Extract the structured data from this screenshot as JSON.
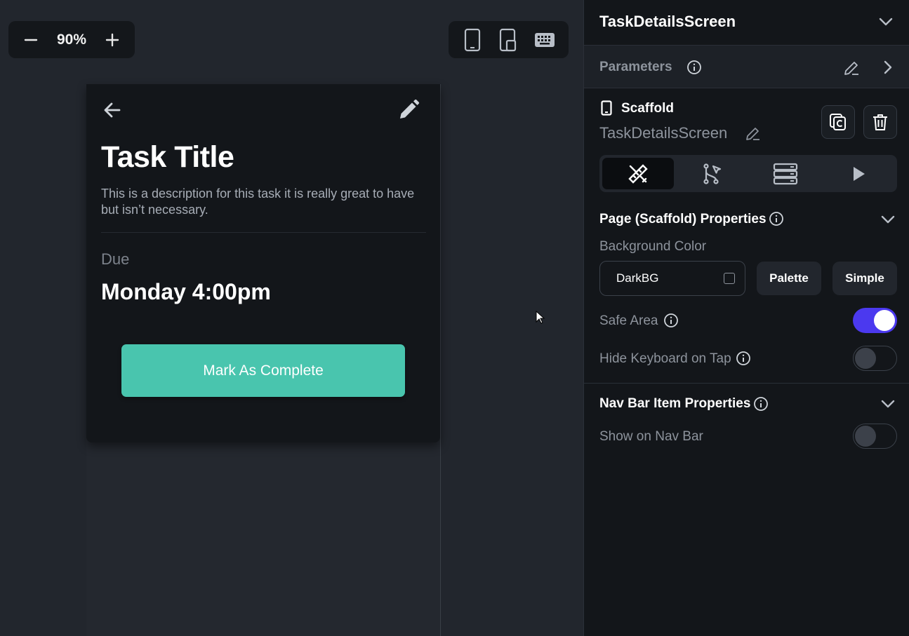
{
  "canvas": {
    "zoom": {
      "value": "90%",
      "decrease_icon": "minus-icon",
      "increase_icon": "plus-icon"
    },
    "device_modes": [
      "phone-icon",
      "tablet-icon",
      "keyboard-icon"
    ]
  },
  "preview": {
    "title": "Task Title",
    "description": "This is a description for this task it is really great to have but isn’t necessary.",
    "due_label": "Due",
    "due_value": "Monday 4:00pm",
    "complete_button": "Mark As Complete",
    "accent_color": "#49c5ae"
  },
  "panel": {
    "screen_name": "TaskDetailsScreen",
    "parameters_label": "Parameters",
    "widget_type": "Scaffold",
    "widget_name": "TaskDetailsScreen",
    "tabs": [
      {
        "icon": "properties-icon",
        "active": true
      },
      {
        "icon": "actions-icon",
        "active": false
      },
      {
        "icon": "backend-query-icon",
        "active": false
      },
      {
        "icon": "play-icon",
        "active": false
      }
    ],
    "page_properties": {
      "title": "Page (Scaffold) Properties",
      "background_label": "Background Color",
      "background_value": "DarkBG",
      "palette_button": "Palette",
      "simple_button": "Simple",
      "safe_area_label": "Safe Area",
      "safe_area_on": true,
      "hide_keyboard_label": "Hide Keyboard on Tap",
      "hide_keyboard_on": false
    },
    "nav_bar_properties": {
      "title": "Nav Bar Item Properties",
      "show_label": "Show on Nav Bar",
      "show_on": false
    },
    "toggle_on_color": "#4b39ef"
  }
}
